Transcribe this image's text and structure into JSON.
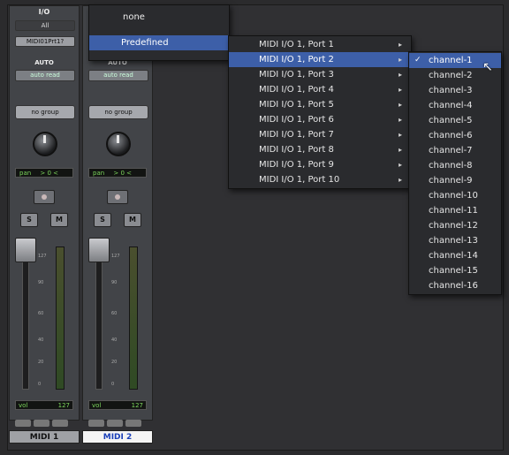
{
  "strips": [
    {
      "io_label": "I/O",
      "input": "All",
      "output": "MIDI01Prt1?",
      "auto_label": "AUTO",
      "auto_mode": "auto read",
      "group": "no group",
      "pan_label": "pan",
      "pan_value": "> 0 <",
      "solo": "S",
      "mute": "M",
      "vol_label": "vol",
      "vol_value": "127",
      "name": "MIDI 1",
      "scale": [
        "127",
        "90",
        "60",
        "40",
        "20",
        "0"
      ]
    },
    {
      "io_label": "",
      "input": "",
      "output": "",
      "auto_label": "AUTO",
      "auto_mode": "auto read",
      "group": "no group",
      "pan_label": "pan",
      "pan_value": "> 0 <",
      "solo": "S",
      "mute": "M",
      "vol_label": "vol",
      "vol_value": "127",
      "name": "MIDI 2",
      "scale": [
        "127",
        "90",
        "60",
        "40",
        "20",
        "0"
      ]
    }
  ],
  "menu1": {
    "none": "none",
    "predefined": "Predefined",
    "arrow": "▸"
  },
  "menu2": {
    "items": [
      "MIDI I/O 1, Port 1",
      "MIDI I/O 1, Port 2",
      "MIDI I/O 1, Port 3",
      "MIDI I/O 1, Port 4",
      "MIDI I/O 1, Port 5",
      "MIDI I/O 1, Port 6",
      "MIDI I/O 1, Port 7",
      "MIDI I/O 1, Port 8",
      "MIDI I/O 1, Port 9",
      "MIDI I/O 1, Port 10"
    ],
    "selected_index": 1,
    "arrow": "▸"
  },
  "menu3": {
    "items": [
      "channel-1",
      "channel-2",
      "channel-3",
      "channel-4",
      "channel-5",
      "channel-6",
      "channel-7",
      "channel-8",
      "channel-9",
      "channel-10",
      "channel-11",
      "channel-12",
      "channel-13",
      "channel-14",
      "channel-15",
      "channel-16"
    ],
    "selected_index": 0,
    "check": "✓"
  },
  "colors": {
    "menu_highlight": "#3d5fa8",
    "display_text": "#7cd65c"
  }
}
